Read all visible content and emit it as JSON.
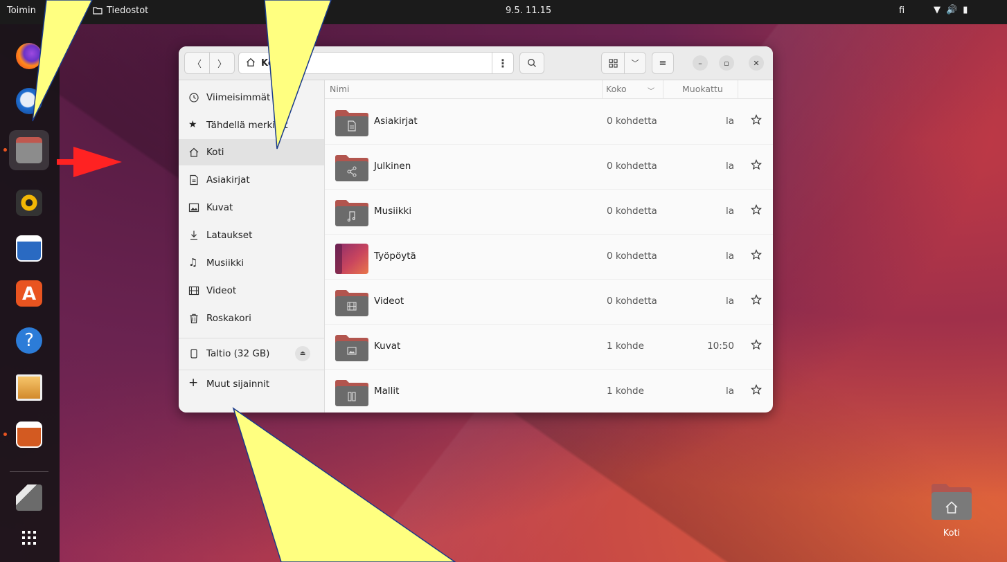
{
  "topbar": {
    "activities": "Toimin",
    "app_name": "Tiedostot",
    "clock": "9.5.  11.15",
    "language": "fi"
  },
  "dock": {
    "items": [
      "firefox-icon",
      "thunderbird-icon",
      "files-icon",
      "rhythmbox-icon",
      "writer-icon",
      "software-icon",
      "help-icon",
      "shotwell-icon",
      "impress-icon",
      "sd-card-icon",
      "app-grid-icon"
    ]
  },
  "window": {
    "path_label": "Ko",
    "columns": {
      "name": "Nimi",
      "size": "Koko",
      "modified": "Muokattu"
    },
    "sidebar": [
      {
        "label": "Viimeisimmät",
        "icon": "clock-icon"
      },
      {
        "label": "Tähdellä merkityt",
        "icon": "star-icon"
      },
      {
        "label": "Koti",
        "icon": "home-icon",
        "selected": true
      },
      {
        "label": "Asiakirjat",
        "icon": "document-icon"
      },
      {
        "label": "Kuvat",
        "icon": "image-icon"
      },
      {
        "label": "Lataukset",
        "icon": "download-icon"
      },
      {
        "label": "Musiikki",
        "icon": "music-icon"
      },
      {
        "label": "Videot",
        "icon": "video-icon"
      },
      {
        "label": "Roskakori",
        "icon": "trash-icon"
      }
    ],
    "device": {
      "label": "Taltio (32 GB)"
    },
    "other_locations": "Muut sijainnit",
    "files": [
      {
        "name": "Asiakirjat",
        "size": "0 kohdetta",
        "modified": "la",
        "icon": "document-icon"
      },
      {
        "name": "Julkinen",
        "size": "0 kohdetta",
        "modified": "la",
        "icon": "share-icon"
      },
      {
        "name": "Musiikki",
        "size": "0 kohdetta",
        "modified": "la",
        "icon": "music-icon"
      },
      {
        "name": "Työpöytä",
        "size": "0 kohdetta",
        "modified": "la",
        "icon": "desktop-icon"
      },
      {
        "name": "Videot",
        "size": "0 kohdetta",
        "modified": "la",
        "icon": "video-icon"
      },
      {
        "name": "Kuvat",
        "size": "1 kohde",
        "modified": "10:50",
        "icon": "image-icon"
      },
      {
        "name": "Mallit",
        "size": "1 kohde",
        "modified": "la",
        "icon": "template-icon"
      }
    ]
  },
  "desktop": {
    "home_label": "Koti"
  },
  "colors": {
    "accent": "#e95420",
    "folder_top": "#b2554e",
    "folder_body": "#6b6b6b",
    "callout": "#ffff80",
    "arrow": "#ff2222"
  }
}
